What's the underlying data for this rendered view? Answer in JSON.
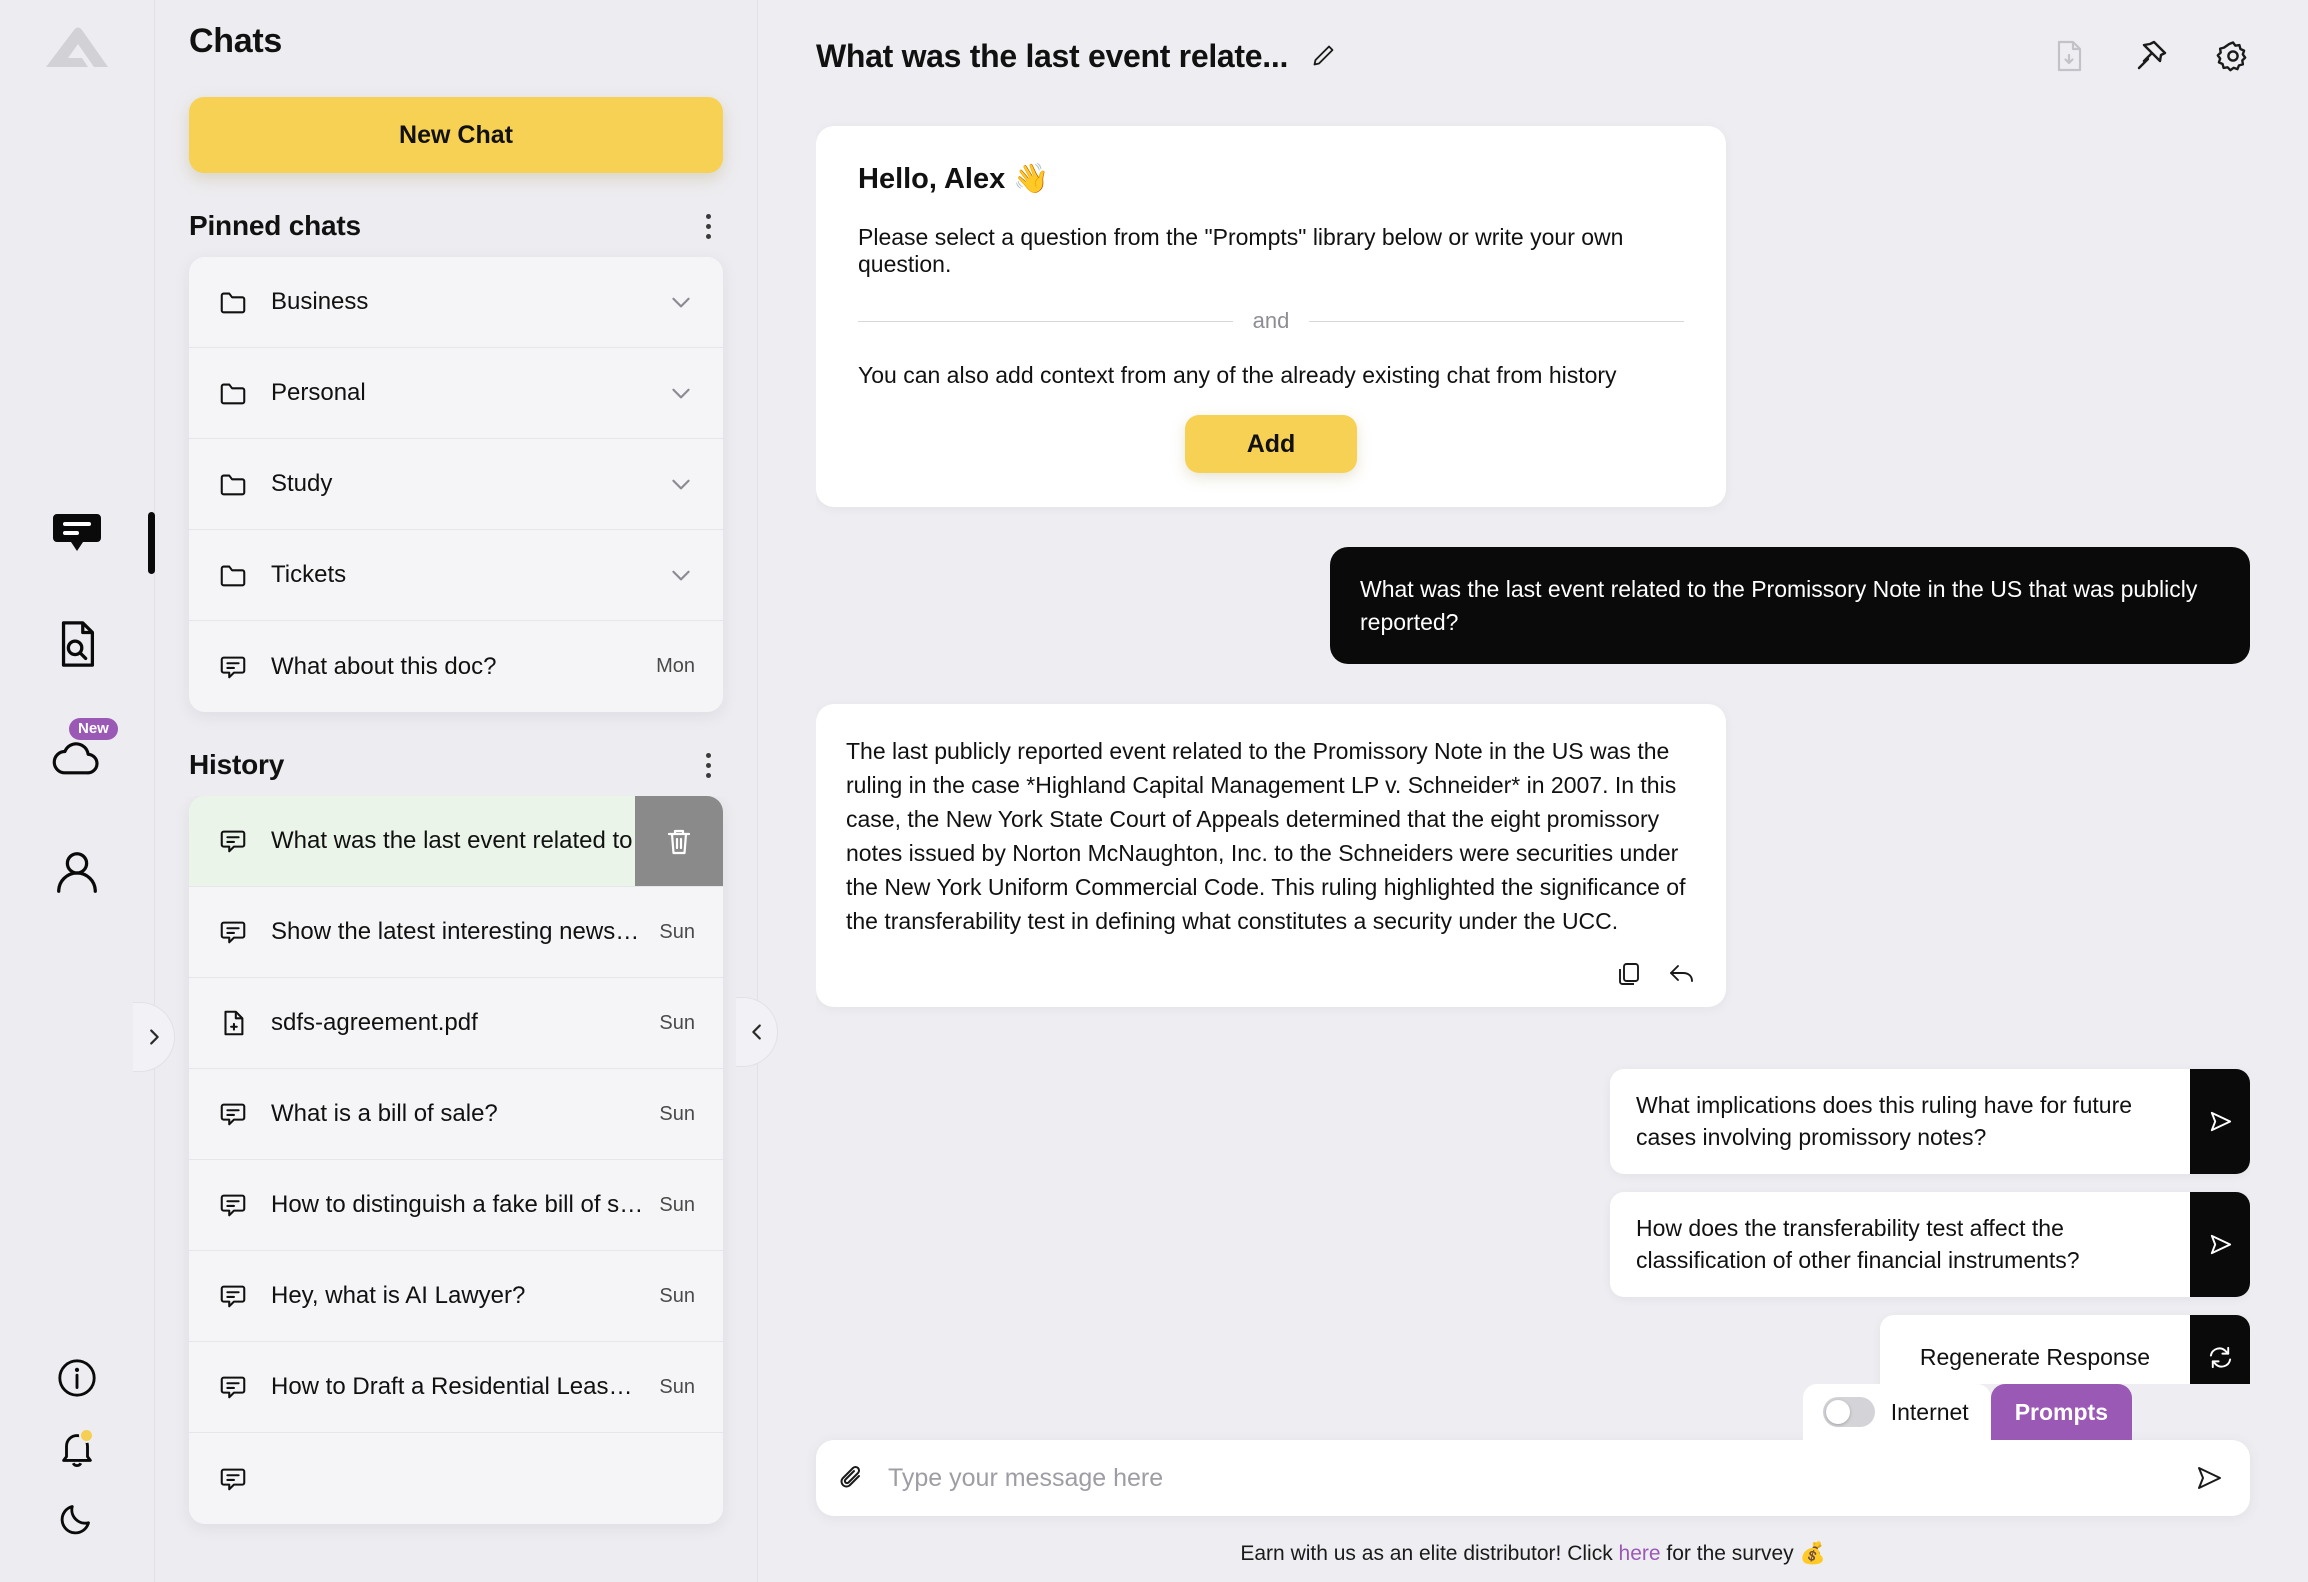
{
  "brand": {
    "logo_name": "app-logo",
    "accent_yellow": "#f7d154",
    "accent_purple": "#9b59b6",
    "selected_green": "#eaf4e8"
  },
  "rail": {
    "items": [
      {
        "icon": "chat-bubble-icon",
        "active": true
      },
      {
        "icon": "document-search-icon",
        "active": false
      },
      {
        "icon": "cloud-icon",
        "badge": "New",
        "active": false
      },
      {
        "icon": "user-profile-icon",
        "active": false
      }
    ],
    "bottom": [
      {
        "icon": "info-icon"
      },
      {
        "icon": "bell-icon"
      },
      {
        "icon": "moon-icon"
      }
    ]
  },
  "sidebar": {
    "title": "Chats",
    "new_chat_label": "New Chat",
    "pinned": {
      "heading": "Pinned chats",
      "items": [
        {
          "icon": "folder-icon",
          "label": "Business",
          "trailing": "chevron-down-icon",
          "meta": ""
        },
        {
          "icon": "folder-icon",
          "label": "Personal",
          "trailing": "chevron-down-icon",
          "meta": ""
        },
        {
          "icon": "folder-icon",
          "label": "Study",
          "trailing": "chevron-down-icon",
          "meta": ""
        },
        {
          "icon": "folder-icon",
          "label": "Tickets",
          "trailing": "chevron-down-icon",
          "meta": ""
        },
        {
          "icon": "chat-icon",
          "label": "What about this doc?",
          "trailing": "",
          "meta": "Mon"
        }
      ]
    },
    "history": {
      "heading": "History",
      "items": [
        {
          "icon": "chat-icon",
          "label": "What was the last event related to the.",
          "meta": "",
          "selected": true,
          "delete_icon": "trash-icon"
        },
        {
          "icon": "chat-icon",
          "label": "Show the latest interesting news or u…",
          "meta": "Sun",
          "selected": false
        },
        {
          "icon": "file-icon",
          "label": "sdfs-agreement.pdf",
          "meta": "Sun",
          "selected": false
        },
        {
          "icon": "chat-icon",
          "label": "What is a bill of sale?",
          "meta": "Sun",
          "selected": false
        },
        {
          "icon": "chat-icon",
          "label": "How to distinguish a fake bill of sale f…",
          "meta": "Sun",
          "selected": false
        },
        {
          "icon": "chat-icon",
          "label": "Hey, what is AI Lawyer?",
          "meta": "Sun",
          "selected": false
        },
        {
          "icon": "chat-icon",
          "label": "How to Draft a Residential Lease Agre…",
          "meta": "Sun",
          "selected": false
        }
      ]
    }
  },
  "main": {
    "chat_title": "What was the last event relate...",
    "header_icons": [
      "download-document-icon",
      "pin-icon",
      "gear-icon"
    ],
    "welcome": {
      "greeting": "Hello, Alex 👋",
      "line1": "Please select a question from the \"Prompts\" library below or write your own question.",
      "divider_label": "and",
      "line2": "You can also add context from any of the already existing chat from history",
      "add_label": "Add"
    },
    "user_message": "What was the last event related to the Promissory Note in the US that was publicly reported?",
    "ai_message": "The last publicly reported event related to the Promissory Note in the US was the ruling in the case *Highland Capital Management LP v. Schneider* in 2007. In this case, the New York State Court of Appeals determined that the eight promissory notes issued by Norton McNaughton, Inc. to the Schneiders were securities under the New York Uniform Commercial Code. This ruling highlighted the significance of the transferability test in defining what constitutes a security under the UCC.",
    "ai_actions": [
      "copy-icon",
      "reply-icon"
    ],
    "suggestions": [
      {
        "text": "What implications does this ruling have for future cases involving promissory notes?",
        "icon": "send-icon"
      },
      {
        "text": "How does the transferability test affect the classification of other financial instruments?",
        "icon": "send-icon"
      },
      {
        "text": "Regenerate Response",
        "icon": "refresh-icon"
      }
    ],
    "composer": {
      "internet_label": "Internet",
      "internet_on": false,
      "prompts_label": "Prompts",
      "placeholder": "Type your message here",
      "value": "",
      "attach_icon": "paperclip-icon",
      "send_icon": "send-icon"
    },
    "footer": {
      "before": "Earn with us as an elite distributor! Click ",
      "link": "here",
      "after": " for the survey 💰"
    }
  }
}
